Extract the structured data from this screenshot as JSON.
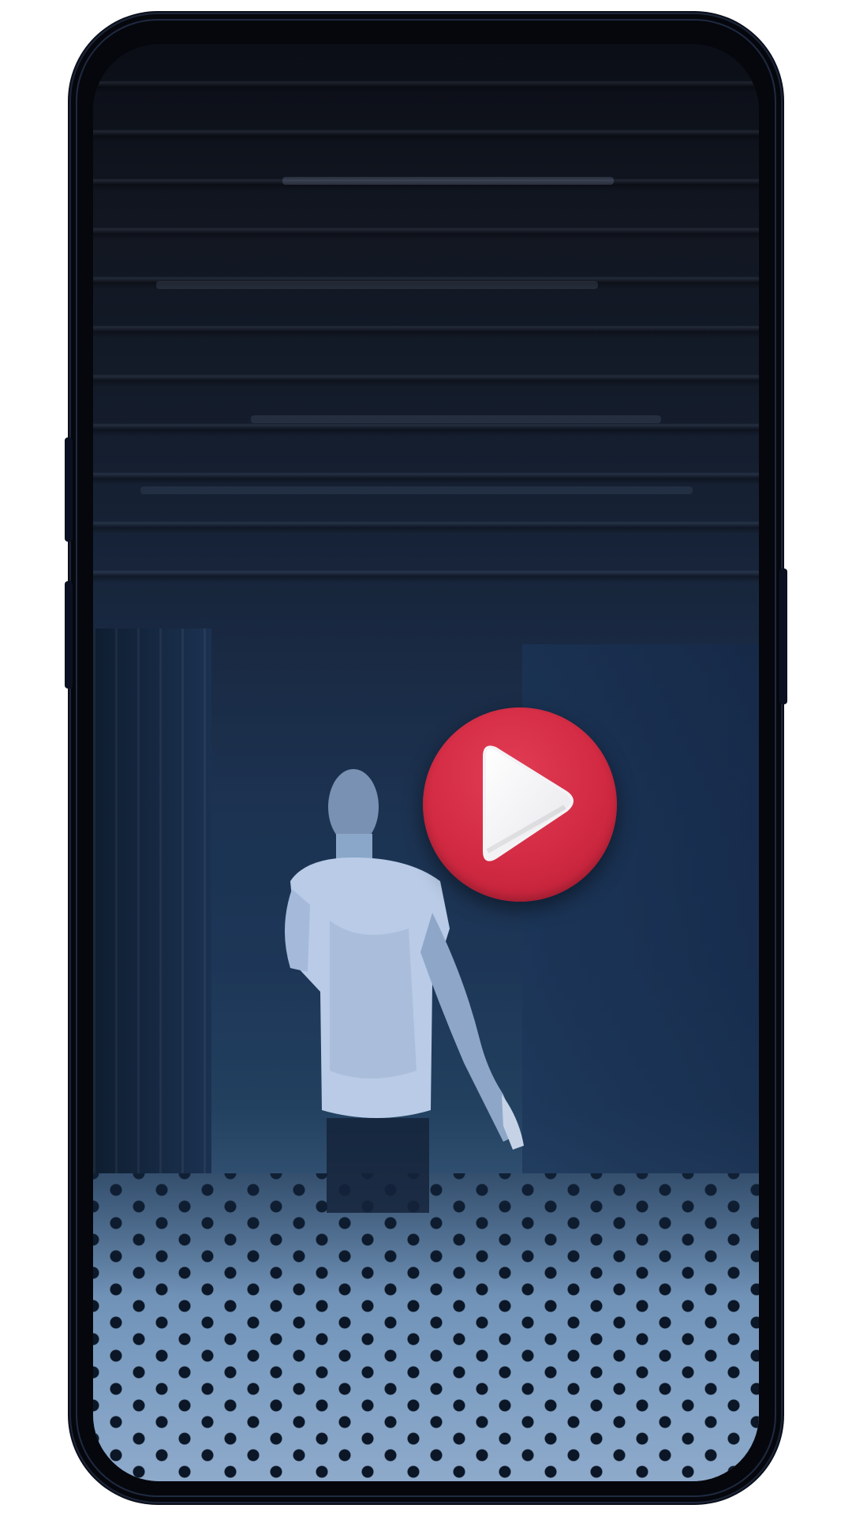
{
  "app": {
    "name": "video-player-mockup"
  },
  "player": {
    "state": "paused",
    "play_icon": "play-icon",
    "accent_color": "#d12a42"
  },
  "device": {
    "type": "smartphone",
    "frame_color": "#05070d"
  }
}
